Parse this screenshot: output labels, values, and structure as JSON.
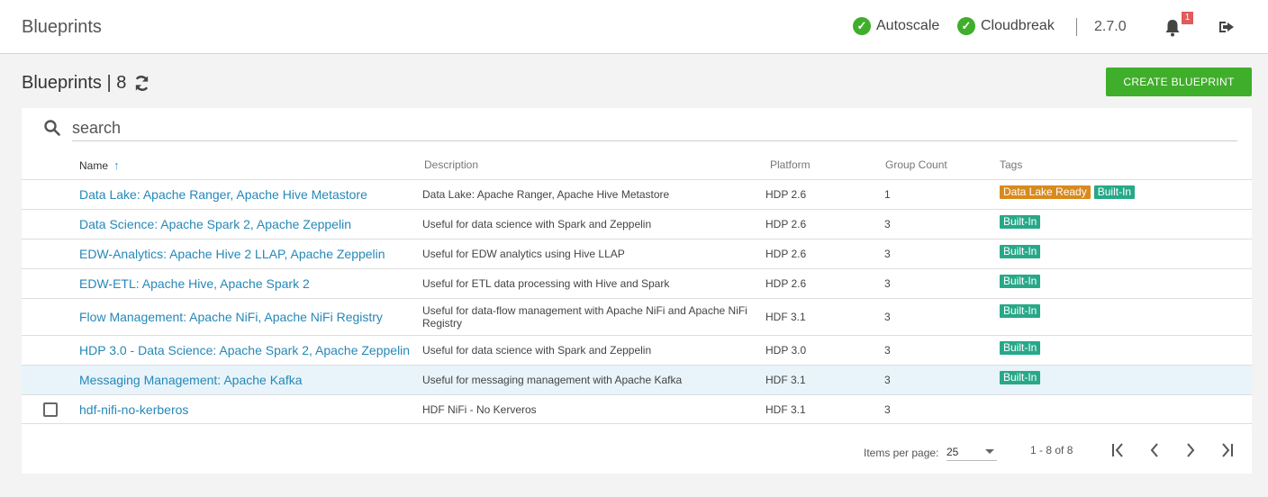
{
  "header": {
    "title": "Blueprints",
    "statuses": [
      {
        "label": "Autoscale",
        "state": "ok"
      },
      {
        "label": "Cloudbreak",
        "state": "ok"
      }
    ],
    "version": "2.7.0",
    "notification_count": "1",
    "icons": {
      "bell": "bell-icon",
      "logout": "logout-icon"
    }
  },
  "page": {
    "heading": "Blueprints | 8",
    "create_button": "CREATE BLUEPRINT"
  },
  "search": {
    "placeholder": "search"
  },
  "table": {
    "columns": {
      "name": "Name",
      "sort_indicator": "↑",
      "description": "Description",
      "platform": "Platform",
      "group_count": "Group Count",
      "tags": "Tags"
    },
    "rows": [
      {
        "name": "Data Lake: Apache Ranger, Apache Hive Metastore",
        "description": "Data Lake: Apache Ranger, Apache Hive Metastore",
        "platform": "HDP 2.6",
        "group_count": "1",
        "tags": [
          "Data Lake Ready",
          "Built-In"
        ]
      },
      {
        "name": "Data Science: Apache Spark 2, Apache Zeppelin",
        "description": "Useful for data science with Spark and Zeppelin",
        "platform": "HDP 2.6",
        "group_count": "3",
        "tags": [
          "Built-In"
        ]
      },
      {
        "name": "EDW-Analytics: Apache Hive 2 LLAP, Apache Zeppelin",
        "description": "Useful for EDW analytics using Hive LLAP",
        "platform": "HDP 2.6",
        "group_count": "3",
        "tags": [
          "Built-In"
        ]
      },
      {
        "name": "EDW-ETL: Apache Hive, Apache Spark 2",
        "description": "Useful for ETL data processing with Hive and Spark",
        "platform": "HDP 2.6",
        "group_count": "3",
        "tags": [
          "Built-In"
        ]
      },
      {
        "name": "Flow Management: Apache NiFi, Apache NiFi Registry",
        "description": "Useful for data-flow management with Apache NiFi and Apache NiFi Registry",
        "platform": "HDF 3.1",
        "group_count": "3",
        "tags": [
          "Built-In"
        ]
      },
      {
        "name": "HDP 3.0 - Data Science: Apache Spark 2, Apache Zeppelin",
        "description": "Useful for data science with Spark and Zeppelin",
        "platform": "HDP 3.0",
        "group_count": "3",
        "tags": [
          "Built-In"
        ]
      },
      {
        "name": "Messaging Management: Apache Kafka",
        "description": "Useful for messaging management with Apache Kafka",
        "platform": "HDF 3.1",
        "group_count": "3",
        "tags": [
          "Built-In"
        ]
      },
      {
        "name": "hdf-nifi-no-kerberos",
        "description": "HDF NiFi - No Kerveros",
        "platform": "HDF 3.1",
        "group_count": "3",
        "tags": [],
        "checkbox": true
      }
    ]
  },
  "pagination": {
    "items_per_page_label": "Items per page:",
    "items_per_page": "25",
    "range": "1 - 8 of 8"
  },
  "colors": {
    "accent": "#3fae2a",
    "link": "#2588b8",
    "builtin_tag": "#27a889",
    "datalake_tag": "#d98a1c"
  }
}
